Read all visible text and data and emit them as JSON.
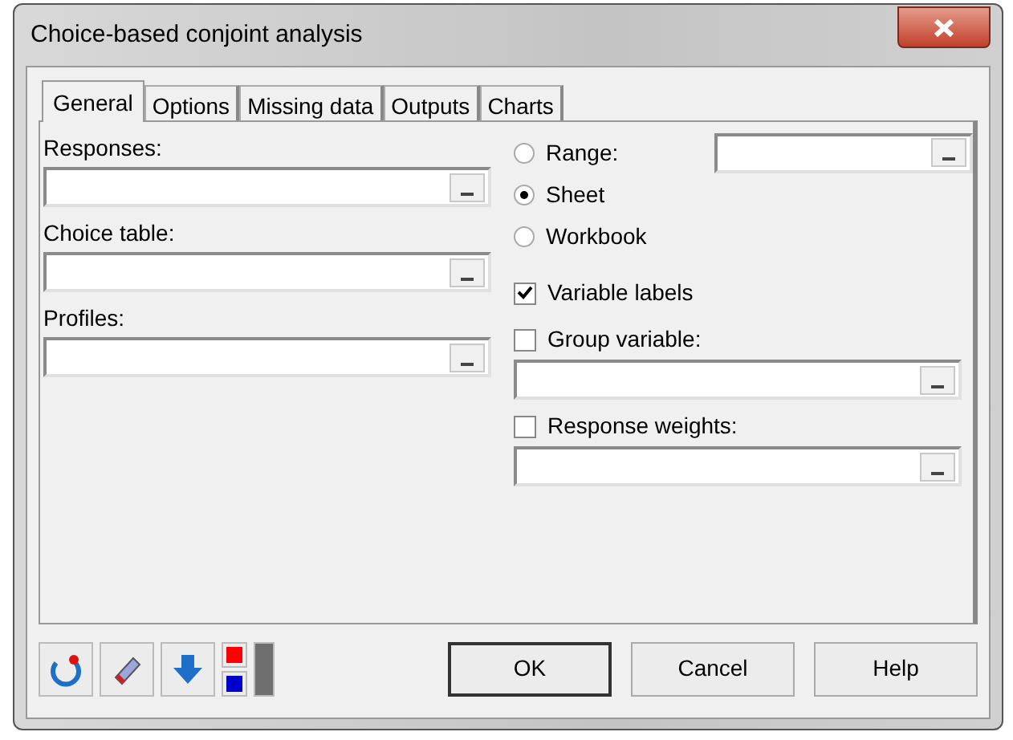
{
  "window": {
    "title": "Choice-based conjoint analysis"
  },
  "tabs": [
    {
      "label": "General",
      "selected": true
    },
    {
      "label": "Options",
      "selected": false
    },
    {
      "label": "Missing data",
      "selected": false
    },
    {
      "label": "Outputs",
      "selected": false
    },
    {
      "label": "Charts",
      "selected": false
    }
  ],
  "left_fields": [
    {
      "label": "Responses:"
    },
    {
      "label": "Choice table:"
    },
    {
      "label": "Profiles:"
    }
  ],
  "position": [
    {
      "label": "Range:",
      "selected": false
    },
    {
      "label": "Sheet",
      "selected": true
    },
    {
      "label": "Workbook",
      "selected": false
    }
  ],
  "options": [
    {
      "label": "Variable labels",
      "checked": true,
      "field": false
    },
    {
      "label": "Group variable:",
      "checked": false,
      "field": true
    },
    {
      "label": "Response weights:",
      "checked": false,
      "field": true
    }
  ],
  "buttons": [
    "OK",
    "Cancel",
    "Help"
  ]
}
